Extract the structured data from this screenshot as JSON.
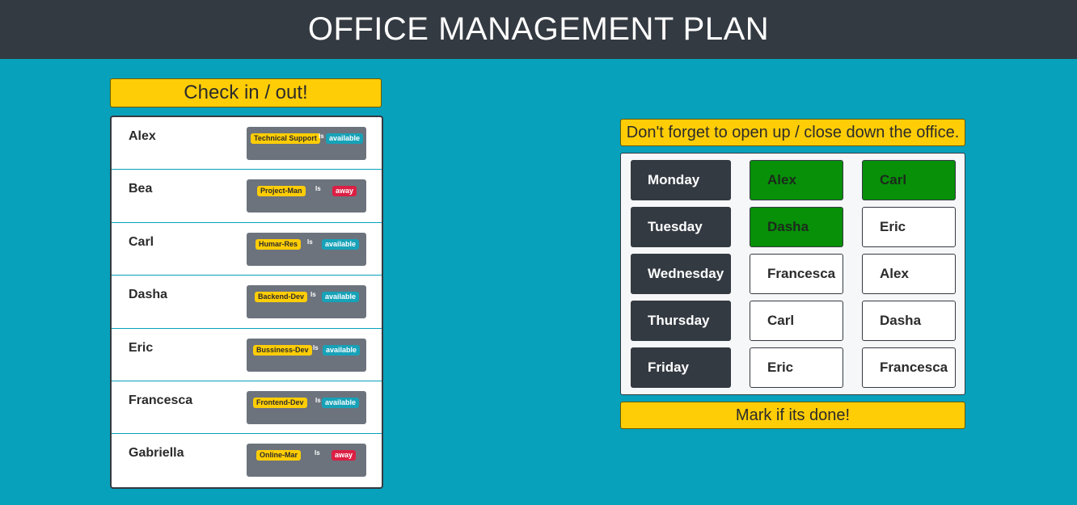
{
  "header": {
    "title": "OFFICE MANAGEMENT PLAN"
  },
  "checkin": {
    "button_label": "Check in / out!"
  },
  "people": [
    {
      "name": "Alex",
      "role": "Technical Support",
      "is": "Is",
      "state": "available"
    },
    {
      "name": "Bea",
      "role": "Project-Man",
      "is": "Is",
      "state": "away"
    },
    {
      "name": "Carl",
      "role": "Humar-Res",
      "is": "Is",
      "state": "available"
    },
    {
      "name": "Dasha",
      "role": "Backend-Dev",
      "is": "Is",
      "state": "available"
    },
    {
      "name": "Eric",
      "role": "Bussiness-Dev",
      "is": "Is",
      "state": "available"
    },
    {
      "name": "Francesca",
      "role": "Frontend-Dev",
      "is": "Is",
      "state": "available"
    },
    {
      "name": "Gabriella",
      "role": "Online-Mar",
      "is": "Is",
      "state": "away"
    }
  ],
  "rota": {
    "reminder": "Don't forget to open up / close down the office.",
    "days": [
      {
        "day": "Monday",
        "open": "Alex",
        "open_done": true,
        "close": "Carl",
        "close_done": true
      },
      {
        "day": "Tuesday",
        "open": "Dasha",
        "open_done": true,
        "close": "Eric",
        "close_done": false
      },
      {
        "day": "Wednesday",
        "open": "Francesca",
        "open_done": false,
        "close": "Alex",
        "close_done": false
      },
      {
        "day": "Thursday",
        "open": "Carl",
        "open_done": false,
        "close": "Dasha",
        "close_done": false
      },
      {
        "day": "Friday",
        "open": "Eric",
        "open_done": false,
        "close": "Francesca",
        "close_done": false
      }
    ],
    "mark_button_label": "Mark if its done!"
  },
  "colors": {
    "background": "#07a1bb",
    "header": "#343a42",
    "accent_yellow": "#ffcd06",
    "available": "#17a2b8",
    "away": "#dc1f44",
    "done_green": "#079008"
  }
}
